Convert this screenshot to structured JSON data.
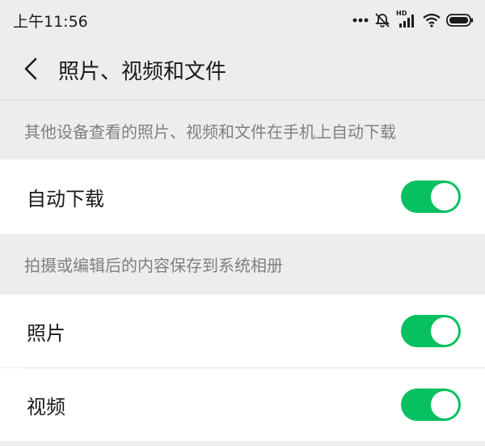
{
  "status_bar": {
    "time": "上午11:56",
    "icons": [
      "dots-icon",
      "alarm-off-icon",
      "hd-signal-icon",
      "wifi-icon",
      "battery-icon"
    ],
    "hd_label": "HD"
  },
  "nav": {
    "back_icon": "chevron-left-icon",
    "title": "照片、视频和文件"
  },
  "sections": [
    {
      "caption": "其他设备查看的照片、视频和文件在手机上自动下载",
      "items": [
        {
          "label": "自动下载",
          "enabled": true
        }
      ]
    },
    {
      "caption": "拍摄或编辑后的内容保存到系统相册",
      "items": [
        {
          "label": "照片",
          "enabled": true
        },
        {
          "label": "视频",
          "enabled": true
        }
      ]
    }
  ],
  "colors": {
    "accent": "#07c160",
    "background": "#ededed",
    "cell": "#ffffff",
    "caption_text": "#808080"
  }
}
